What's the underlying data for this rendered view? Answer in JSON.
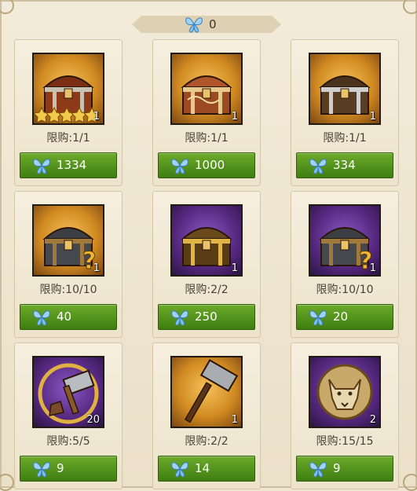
{
  "currency": {
    "icon": "blue-butterfly-icon",
    "value": "0"
  },
  "items": [
    {
      "name": "star-chest-icon",
      "quantity": "1",
      "limit": "限购:1/1",
      "price": "1334",
      "bg": "gold"
    },
    {
      "name": "ornate-chest-icon",
      "quantity": "1",
      "limit": "限购:1/1",
      "price": "1000",
      "bg": "gold"
    },
    {
      "name": "silver-chest-icon",
      "quantity": "1",
      "limit": "限购:1/1",
      "price": "334",
      "bg": "gold"
    },
    {
      "name": "mystery-chest-icon",
      "quantity": "1",
      "limit": "限购:10/10",
      "price": "40",
      "bg": "gold"
    },
    {
      "name": "gold-chest-icon",
      "quantity": "1",
      "limit": "限购:2/2",
      "price": "250",
      "bg": "purple"
    },
    {
      "name": "mystery-chest-icon",
      "quantity": "1",
      "limit": "限购:10/10",
      "price": "20",
      "bg": "purple"
    },
    {
      "name": "hammer-boot-icon",
      "quantity": "20",
      "limit": "限购:5/5",
      "price": "9",
      "bg": "purple"
    },
    {
      "name": "warhammer-icon",
      "quantity": "1",
      "limit": "限购:2/2",
      "price": "14",
      "bg": "gold"
    },
    {
      "name": "wolf-medallion-icon",
      "quantity": "2",
      "limit": "限购:15/15",
      "price": "9",
      "bg": "purple"
    }
  ],
  "colors": {
    "button_green": "#4f9a1c",
    "panel": "#efe6d2",
    "text": "#4a4133"
  }
}
